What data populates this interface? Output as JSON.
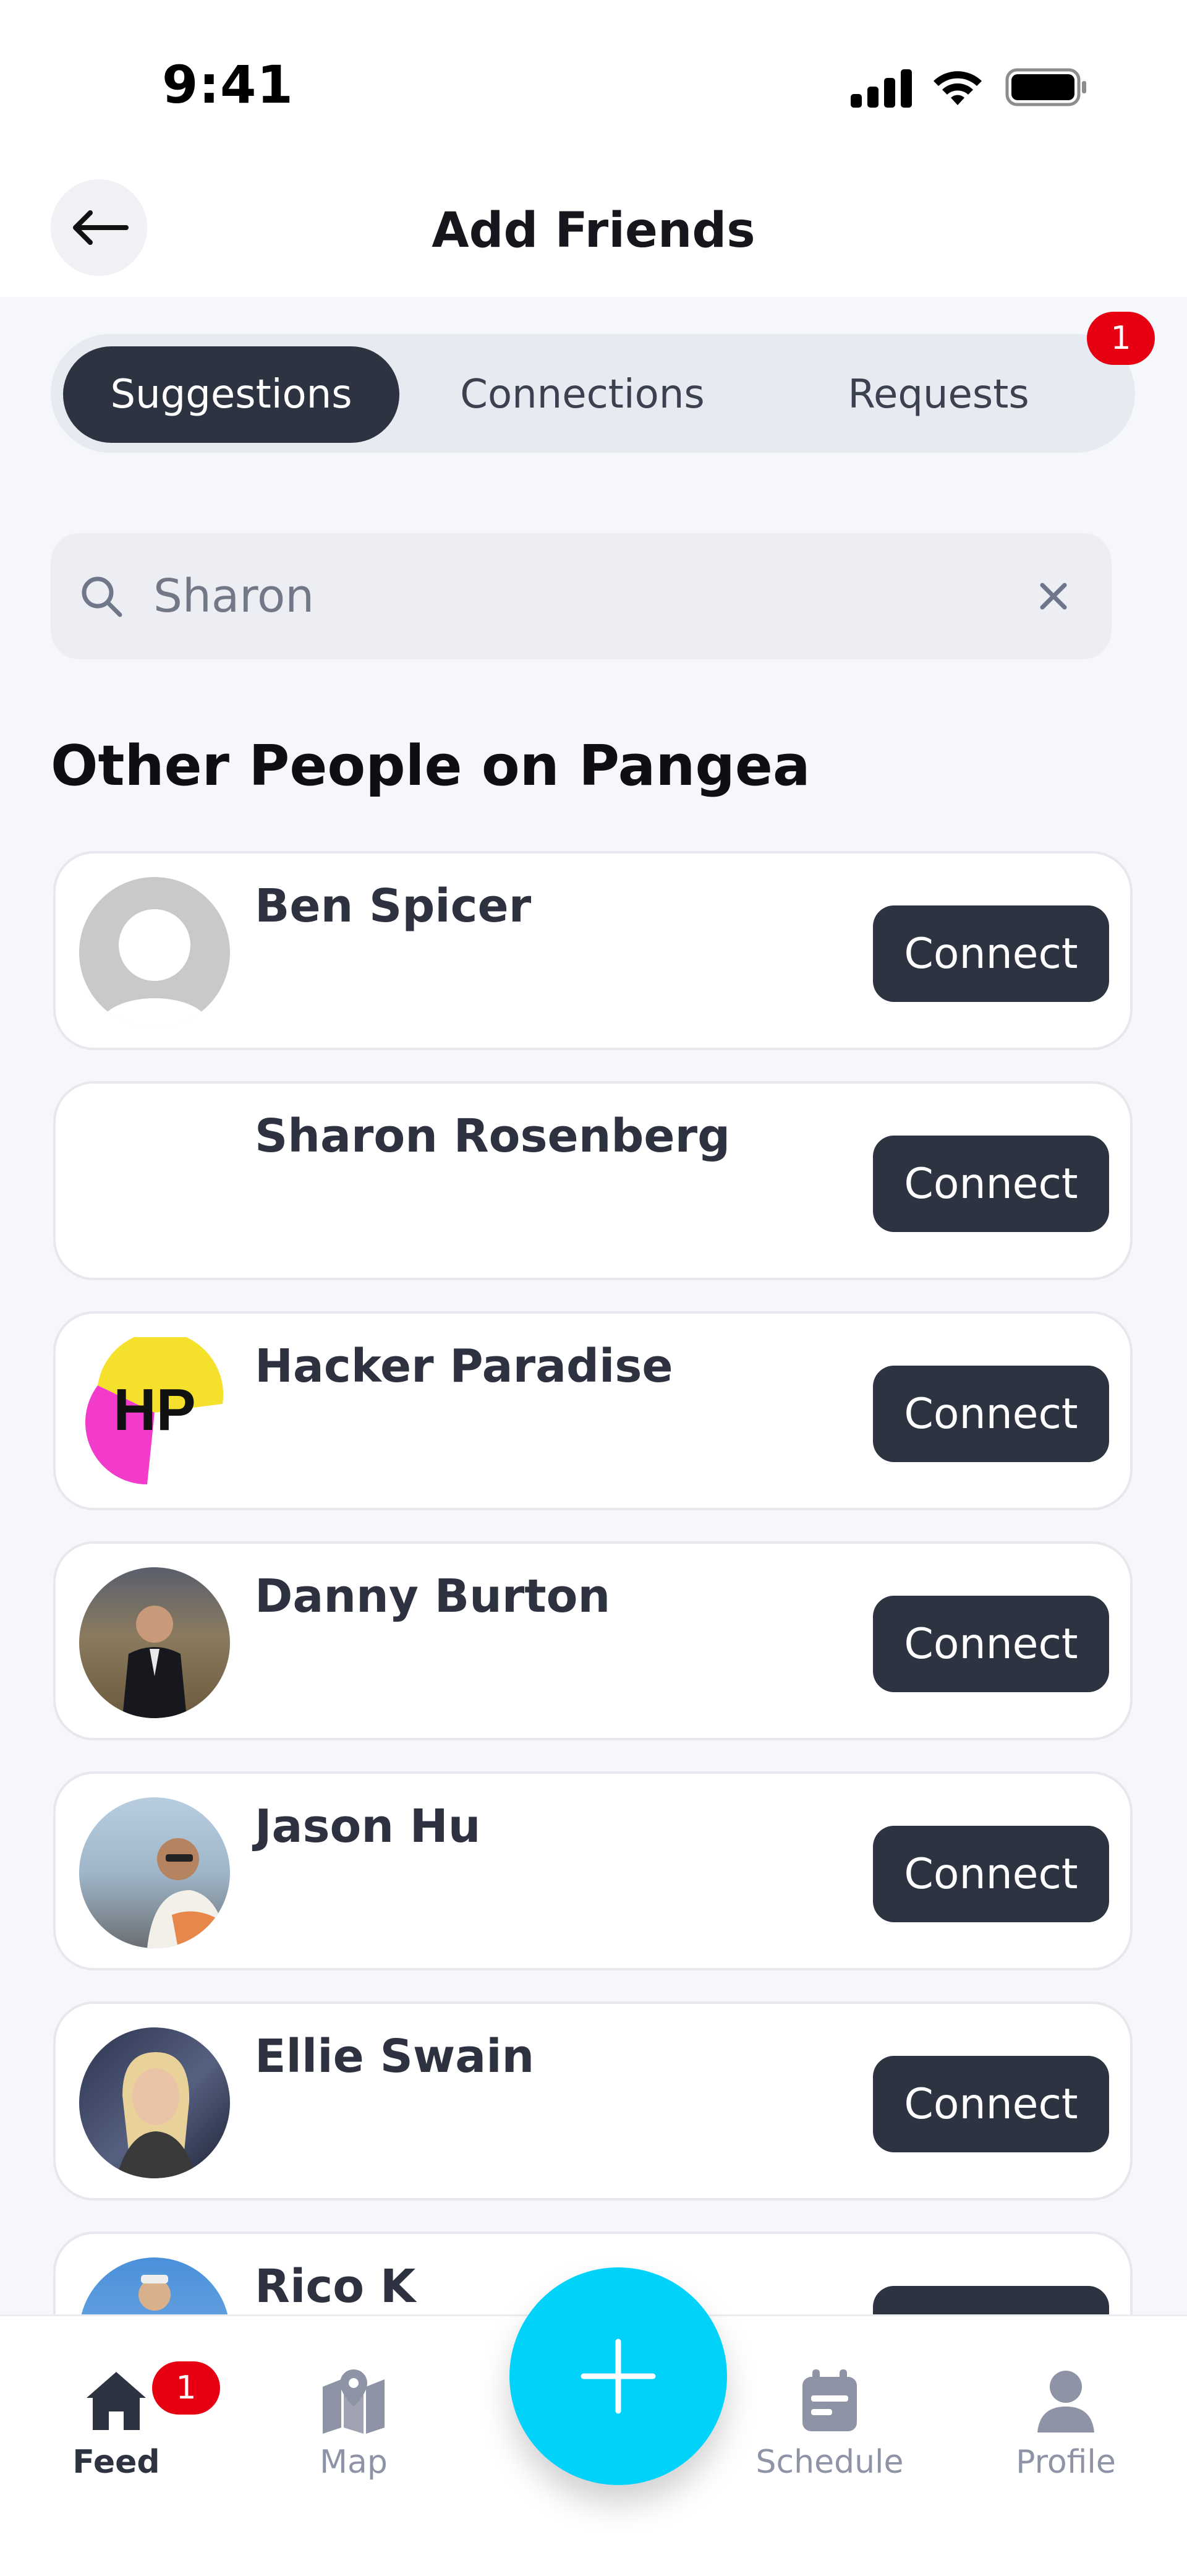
{
  "status_bar": {
    "time": "9:41"
  },
  "nav": {
    "title": "Add Friends"
  },
  "tabs": {
    "items": [
      {
        "label": "Suggestions",
        "active": true
      },
      {
        "label": "Connections",
        "active": false
      },
      {
        "label": "Requests",
        "active": false
      }
    ],
    "requests_badge": "1"
  },
  "search": {
    "value": "Sharon",
    "placeholder": "Search"
  },
  "section": {
    "title": "Other People on Pangea"
  },
  "people": [
    {
      "name": "Ben Spicer",
      "avatar": "placeholder-person",
      "button": "Connect"
    },
    {
      "name": "Sharon Rosenberg",
      "avatar": "none",
      "button": "Connect"
    },
    {
      "name": "Hacker Paradise",
      "avatar": "hp-logo",
      "avatar_text": "HP",
      "button": "Connect"
    },
    {
      "name": "Danny Burton",
      "avatar": "photo",
      "button": "Connect"
    },
    {
      "name": "Jason Hu",
      "avatar": "photo",
      "button": "Connect"
    },
    {
      "name": "Ellie Swain",
      "avatar": "photo",
      "button": "Connect"
    },
    {
      "name": "Rico K",
      "avatar": "photo",
      "button": "Connect"
    }
  ],
  "bottom_nav": {
    "feed": {
      "label": "Feed",
      "badge": "1",
      "icon": "home-icon"
    },
    "map": {
      "label": "Map",
      "icon": "map-icon"
    },
    "schedule": {
      "label": "Schedule",
      "icon": "calendar-icon"
    },
    "profile": {
      "label": "Profile",
      "icon": "person-icon"
    },
    "fab_icon": "plus-icon"
  },
  "colors": {
    "accent": "#00D2FA",
    "dark": "#2E3342",
    "badge": "#E60012",
    "background": "#F6F7FA"
  }
}
